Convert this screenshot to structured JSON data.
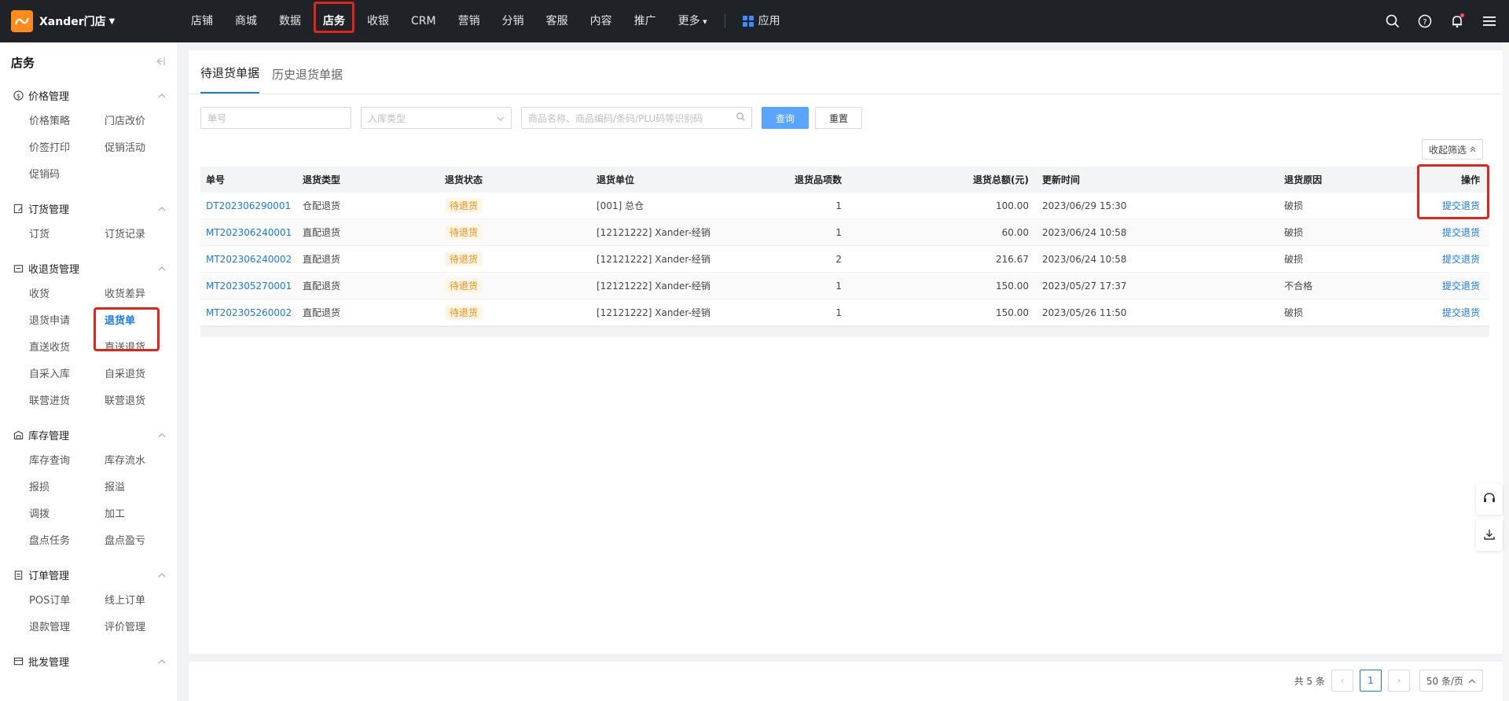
{
  "brand": {
    "store_name": "Xander门店"
  },
  "topnav": [
    "店铺",
    "商城",
    "数据",
    "店务",
    "收银",
    "CRM",
    "营销",
    "分销",
    "客服",
    "内容",
    "推广",
    "更多"
  ],
  "topnav_active": "店务",
  "apps_label": "应用",
  "sidebar": {
    "title": "店务",
    "groups": [
      {
        "title": "价格管理",
        "icon": "dollar-circle-icon",
        "items": [
          "价格策略",
          "门店改价",
          "价签打印",
          "促销活动",
          "促销码"
        ]
      },
      {
        "title": "订货管理",
        "icon": "order-edit-icon",
        "items": [
          "订货",
          "订货记录"
        ]
      },
      {
        "title": "收退货管理",
        "icon": "return-box-icon",
        "items": [
          "收货",
          "收货差异",
          "退货申请",
          "退货单",
          "直送收货",
          "直送退货",
          "自采入库",
          "自采退货",
          "联营进货",
          "联营退货"
        ]
      },
      {
        "title": "库存管理",
        "icon": "warehouse-icon",
        "items": [
          "库存查询",
          "库存流水",
          "报损",
          "报溢",
          "调拨",
          "加工",
          "盘点任务",
          "盘点盈亏"
        ]
      },
      {
        "title": "订单管理",
        "icon": "clipboard-icon",
        "items": [
          "POS订单",
          "线上订单",
          "退款管理",
          "评价管理"
        ]
      },
      {
        "title": "批发管理",
        "icon": "wholesale-icon",
        "items": []
      }
    ],
    "active_item": "退货单"
  },
  "tabs": [
    "待退货单据",
    "历史退货单据"
  ],
  "filters": {
    "order_no_placeholder": "单号",
    "type_placeholder": "入库类型",
    "product_placeholder": "商品名称、商品编码/条码/PLU码等识别码",
    "query_label": "查询",
    "reset_label": "重置",
    "collapse_label": "收起筛选"
  },
  "table": {
    "columns": [
      "单号",
      "退货类型",
      "退货状态",
      "退货单位",
      "退货品项数",
      "退货总额(元)",
      "更新时间",
      "退货原因",
      "操作"
    ],
    "rows": [
      {
        "no": "DT202306290001",
        "type": "仓配退货",
        "status": "待退货",
        "unit": "[001] 总仓",
        "count": "1",
        "amount": "100.00",
        "time": "2023/06/29 15:30",
        "reason": "破损",
        "action": "提交退货"
      },
      {
        "no": "MT202306240001",
        "type": "直配退货",
        "status": "待退货",
        "unit": "[12121222] Xander-经销",
        "count": "1",
        "amount": "60.00",
        "time": "2023/06/24 10:58",
        "reason": "破损",
        "action": "提交退货"
      },
      {
        "no": "MT202306240002",
        "type": "直配退货",
        "status": "待退货",
        "unit": "[12121222] Xander-经销",
        "count": "2",
        "amount": "216.67",
        "time": "2023/06/24 10:58",
        "reason": "破损",
        "action": "提交退货"
      },
      {
        "no": "MT202305270001",
        "type": "直配退货",
        "status": "待退货",
        "unit": "[12121222] Xander-经销",
        "count": "1",
        "amount": "150.00",
        "time": "2023/05/27 17:37",
        "reason": "不合格",
        "action": "提交退货"
      },
      {
        "no": "MT202305260002",
        "type": "直配退货",
        "status": "待退货",
        "unit": "[12121222] Xander-经销",
        "count": "1",
        "amount": "150.00",
        "time": "2023/05/26 11:50",
        "reason": "破损",
        "action": "提交退货"
      }
    ]
  },
  "pager": {
    "total_text": "共 5 条",
    "current_page": "1",
    "page_size": "50 条/页"
  },
  "colors": {
    "accent": "#1677ff",
    "highlight": "#e1251b",
    "topbar": "#1f2328"
  }
}
